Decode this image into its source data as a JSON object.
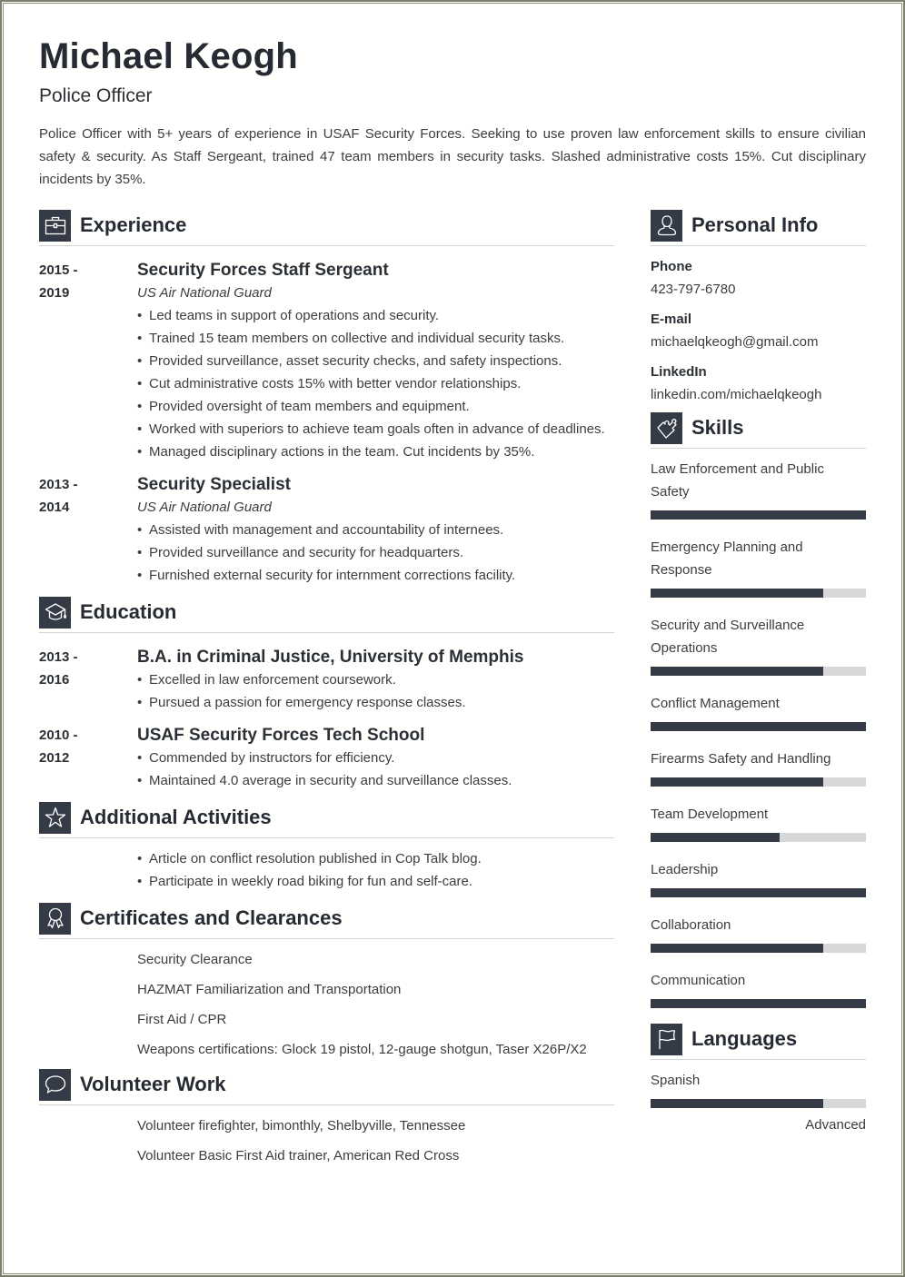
{
  "header": {
    "name": "Michael Keogh",
    "role": "Police Officer",
    "summary": "Police Officer with 5+ years of experience in USAF Security Forces. Seeking to use proven law enforcement skills to ensure civilian safety & security. As Staff Sergeant, trained 47 team members in security tasks. Slashed administrative costs 15%. Cut disciplinary incidents by 35%."
  },
  "colors": {
    "accent": "#343a46",
    "bar_track": "#d6d7d8",
    "divider": "#d2d3d4",
    "frame": "#7d7e6b"
  },
  "experience": {
    "title": "Experience",
    "icon": "briefcase-icon",
    "entries": [
      {
        "dates_start": "2015 -",
        "dates_end": "2019",
        "title": "Security Forces Staff Sergeant",
        "org": "US Air National Guard",
        "bullets": [
          "Led teams in support of operations and security.",
          "Trained 15 team members on collective and individual security tasks.",
          "Provided surveillance, asset security checks, and safety inspections.",
          "Cut administrative costs 15% with better vendor relationships.",
          "Provided oversight of team members and equipment.",
          "Worked with superiors to achieve team goals often in advance of deadlines.",
          "Managed disciplinary actions in the team. Cut incidents by 35%."
        ]
      },
      {
        "dates_start": "2013 -",
        "dates_end": "2014",
        "title": "Security Specialist",
        "org": "US Air National Guard",
        "bullets": [
          "Assisted with management and accountability of internees.",
          "Provided surveillance and security for headquarters.",
          "Furnished external security for internment corrections facility."
        ]
      }
    ]
  },
  "education": {
    "title": "Education",
    "icon": "graduation-cap-icon",
    "entries": [
      {
        "dates_start": "2013 -",
        "dates_end": "2016",
        "title": "B.A. in Criminal Justice, University of Memphis",
        "bullets": [
          "Excelled in law enforcement coursework.",
          "Pursued a passion for emergency response classes."
        ]
      },
      {
        "dates_start": "2010 -",
        "dates_end": "2012",
        "title": "USAF Security Forces Tech School",
        "bullets": [
          "Commended by instructors for efficiency.",
          "Maintained 4.0 average in security and surveillance classes."
        ]
      }
    ]
  },
  "activities": {
    "title": "Additional Activities",
    "icon": "star-icon",
    "bullets": [
      "Article on conflict resolution published in Cop Talk blog.",
      "Participate in weekly road biking for fun and self-care."
    ]
  },
  "certificates": {
    "title": "Certificates and Clearances",
    "icon": "award-ribbon-icon",
    "items": [
      "Security Clearance",
      "HAZMAT Familiarization and Transportation",
      "First Aid / CPR",
      "Weapons certifications: Glock 19 pistol, 12-gauge shotgun, Taser X26P/X2"
    ]
  },
  "volunteer": {
    "title": "Volunteer Work",
    "icon": "speech-bubble-icon",
    "items": [
      "Volunteer firefighter, bimonthly, Shelbyville, Tennessee",
      "Volunteer Basic First Aid trainer, American Red Cross"
    ]
  },
  "personal_info": {
    "title": "Personal Info",
    "icon": "user-icon",
    "fields": [
      {
        "label": "Phone",
        "value": "423-797-6780"
      },
      {
        "label": "E-mail",
        "value": "michaelqkeogh@gmail.com"
      },
      {
        "label": "LinkedIn",
        "value": "linkedin.com/michaelqkeogh"
      }
    ]
  },
  "skills": {
    "title": "Skills",
    "icon": "puzzle-piece-icon",
    "items": [
      {
        "name": "Law Enforcement and Public Safety",
        "level": 1.0
      },
      {
        "name": "Emergency Planning and Response",
        "level": 0.8
      },
      {
        "name": "Security and Surveillance Operations",
        "level": 0.8
      },
      {
        "name": "Conflict Management",
        "level": 1.0
      },
      {
        "name": "Firearms Safety and Handling",
        "level": 0.8
      },
      {
        "name": "Team Development",
        "level": 0.6
      },
      {
        "name": "Leadership",
        "level": 1.0
      },
      {
        "name": "Collaboration",
        "level": 0.8
      },
      {
        "name": "Communication",
        "level": 1.0
      }
    ]
  },
  "languages": {
    "title": "Languages",
    "icon": "flag-icon",
    "items": [
      {
        "name": "Spanish",
        "level": 0.8,
        "level_label": "Advanced"
      }
    ]
  }
}
